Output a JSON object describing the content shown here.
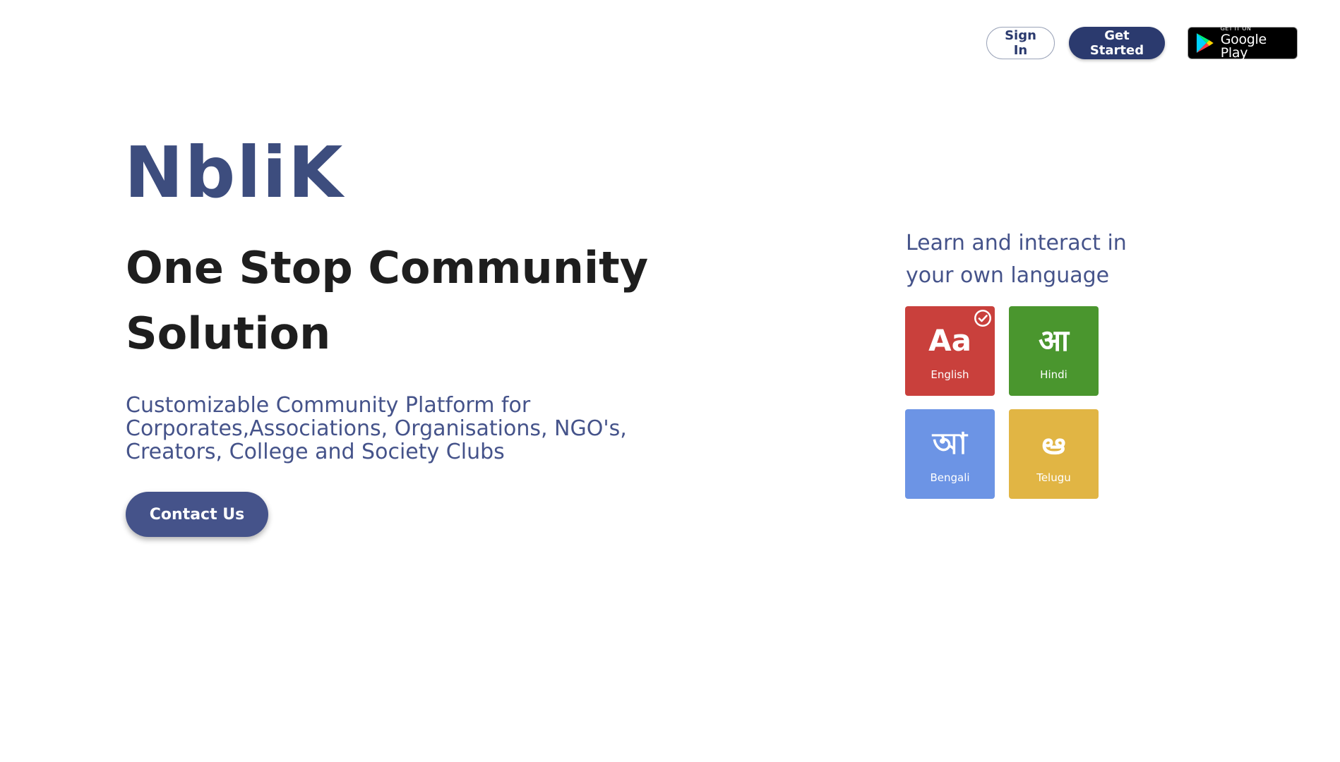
{
  "header": {
    "sign_in_label": "Sign In",
    "get_started_label": "Get Started",
    "google_play": {
      "small": "GET IT ON",
      "big": "Google Play",
      "icon": "google-play-icon"
    }
  },
  "logo": {
    "text": "NbliK"
  },
  "hero": {
    "title": "One Stop Community Solution",
    "subtitle": "Customizable Community Platform for Corporates,Associations, Organisations, NGO's, Creators, College and Society Clubs",
    "contact_label": "Contact Us"
  },
  "languages": {
    "heading": "Learn and interact in your own language",
    "items": [
      {
        "glyph": "Aa",
        "name": "English",
        "color": "#c9403c",
        "selected": true
      },
      {
        "glyph": "आ",
        "name": "Hindi",
        "color": "#4a962e",
        "selected": false
      },
      {
        "glyph": "আ",
        "name": "Bengali",
        "color": "#6c94e5",
        "selected": false
      },
      {
        "glyph": "ఆ",
        "name": "Telugu",
        "color": "#e1b544",
        "selected": false
      }
    ]
  },
  "colors": {
    "brand": "#2b3a6e",
    "accent": "#45538a",
    "title": "#1e1e1e"
  }
}
